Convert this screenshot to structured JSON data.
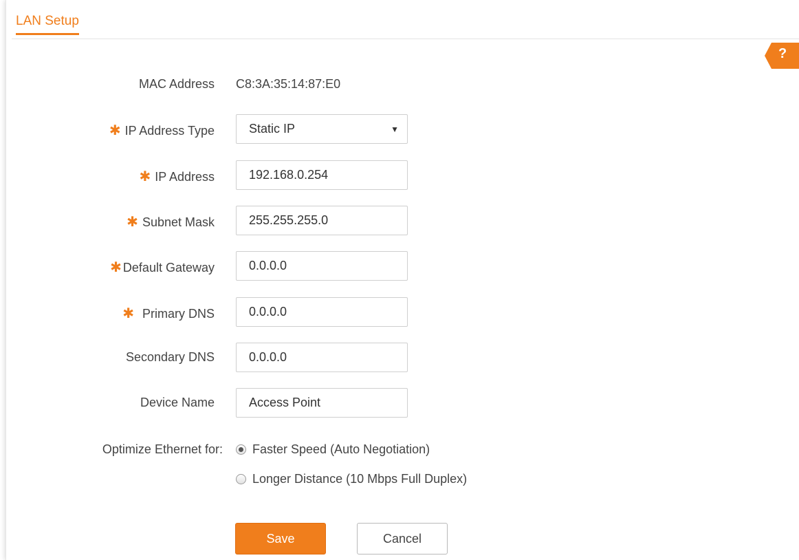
{
  "header": {
    "title": "LAN Setup"
  },
  "help": {
    "label": "?"
  },
  "form": {
    "mac": {
      "label": "MAC Address",
      "value": "C8:3A:35:14:87:E0"
    },
    "ip_type": {
      "label": "IP Address Type",
      "value": "Static IP",
      "required_mark": "✱"
    },
    "ip_address": {
      "label": "IP Address",
      "value": "192.168.0.254",
      "required_mark": "✱"
    },
    "subnet_mask": {
      "label": "Subnet Mask",
      "value": "255.255.255.0",
      "required_mark": "✱"
    },
    "default_gateway": {
      "label": "Default Gateway",
      "value": "0.0.0.0",
      "required_mark": "✱"
    },
    "primary_dns": {
      "label": "Primary DNS",
      "value": "0.0.0.0",
      "required_mark": "✱"
    },
    "secondary_dns": {
      "label": "Secondary DNS",
      "value": "0.0.0.0"
    },
    "device_name": {
      "label": "Device Name",
      "value": "Access Point"
    },
    "optimize": {
      "label": "Optimize Ethernet for:",
      "options": [
        {
          "label": "Faster Speed (Auto Negotiation)",
          "selected": true
        },
        {
          "label": "Longer Distance (10 Mbps Full Duplex)",
          "selected": false
        }
      ]
    }
  },
  "actions": {
    "save": "Save",
    "cancel": "Cancel"
  },
  "colors": {
    "accent": "#f07e1c"
  }
}
